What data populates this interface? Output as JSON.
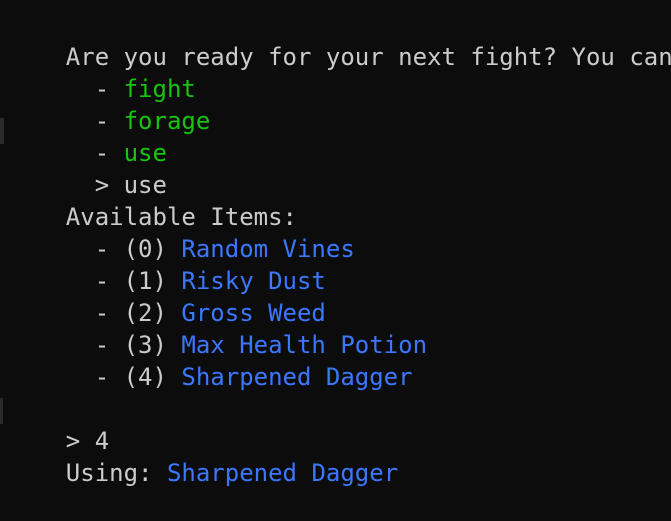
{
  "prompt": {
    "question": "Are you ready for your next fight? You can:"
  },
  "options": [
    {
      "bullet": "  - ",
      "label": "fight"
    },
    {
      "bullet": "  - ",
      "label": "forage"
    },
    {
      "bullet": "  - ",
      "label": "use"
    }
  ],
  "selection": {
    "marker": "  > ",
    "label": "use"
  },
  "inventory": {
    "title": "Available Items:",
    "items": [
      {
        "prefix": "  - (0) ",
        "name": "Random Vines"
      },
      {
        "prefix": "  - (1) ",
        "name": "Risky Dust"
      },
      {
        "prefix": "  - (2) ",
        "name": "Gross Weed"
      },
      {
        "prefix": "  - (3) ",
        "name": "Max Health Potion"
      },
      {
        "prefix": "  - (4) ",
        "name": "Sharpened Dagger"
      }
    ]
  },
  "input": {
    "text": "> 4"
  },
  "result": {
    "prefix": "Using: ",
    "item": "Sharpened Dagger"
  },
  "colors": {
    "background": "#0c0c0c",
    "text": "#cccccc",
    "option": "#16c60c",
    "item": "#3b78ff"
  }
}
